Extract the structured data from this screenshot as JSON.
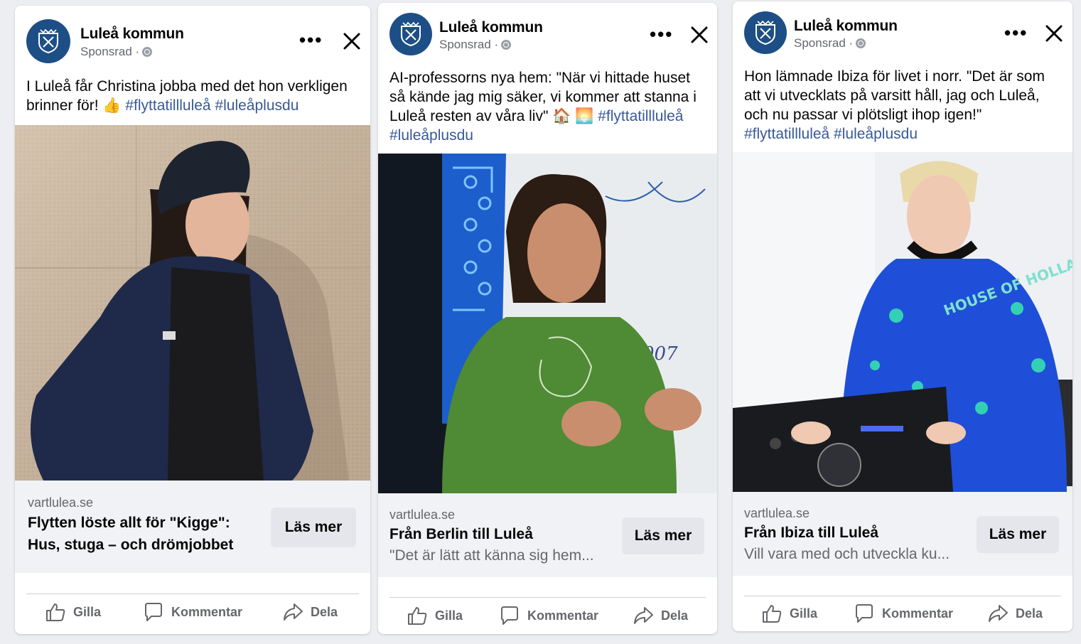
{
  "posts": [
    {
      "page_name": "Luleå kommun",
      "sponsored": "Sponsrad ·",
      "text_before": "I Luleå får Christina jobba med det hon verkligen brinner för! 👍",
      "hashtags": "#flyttatillluleå #luleåplusdu",
      "link_domain": "vartlulea.se",
      "headline": "Flytten löste allt för \"Kigge\": Hus, stuga – och drömjobbet",
      "description": "",
      "cta": "Läs mer",
      "actions": {
        "like": "Gilla",
        "comment": "Kommentar",
        "share": "Dela"
      }
    },
    {
      "page_name": "Luleå kommun",
      "sponsored": "Sponsrad ·",
      "text_before": "AI-professorns nya hem: \"När vi hittade huset så kände jag mig säker, vi kommer att stanna i Luleå resten av våra liv\" 🏠 🌅",
      "hashtags": "#flyttatillluleå #luleåplusdu",
      "link_domain": "vartlulea.se",
      "headline": "Från Berlin till Luleå",
      "description": "\"Det är lätt att känna sig hem...",
      "cta": "Läs mer",
      "actions": {
        "like": "Gilla",
        "comment": "Kommentar",
        "share": "Dela"
      }
    },
    {
      "page_name": "Luleå kommun",
      "sponsored": "Sponsrad ·",
      "text_before": "Hon lämnade Ibiza för livet i norr. \"Det är som att vi utvecklats på varsitt håll, jag och Luleå, och nu passar vi plötsligt ihop igen!\"",
      "hashtags": "#flyttatillluleå #luleåplusdu",
      "link_domain": "vartlulea.se",
      "headline": "Från Ibiza till Luleå",
      "description": "Vill vara med och utveckla ku...",
      "cta": "Läs mer",
      "actions": {
        "like": "Gilla",
        "comment": "Kommentar",
        "share": "Dela"
      }
    }
  ],
  "colors": {
    "link": "#385898",
    "brand": "#1d4f86",
    "secondary_text": "#65676b",
    "button_bg": "#e4e6eb"
  }
}
